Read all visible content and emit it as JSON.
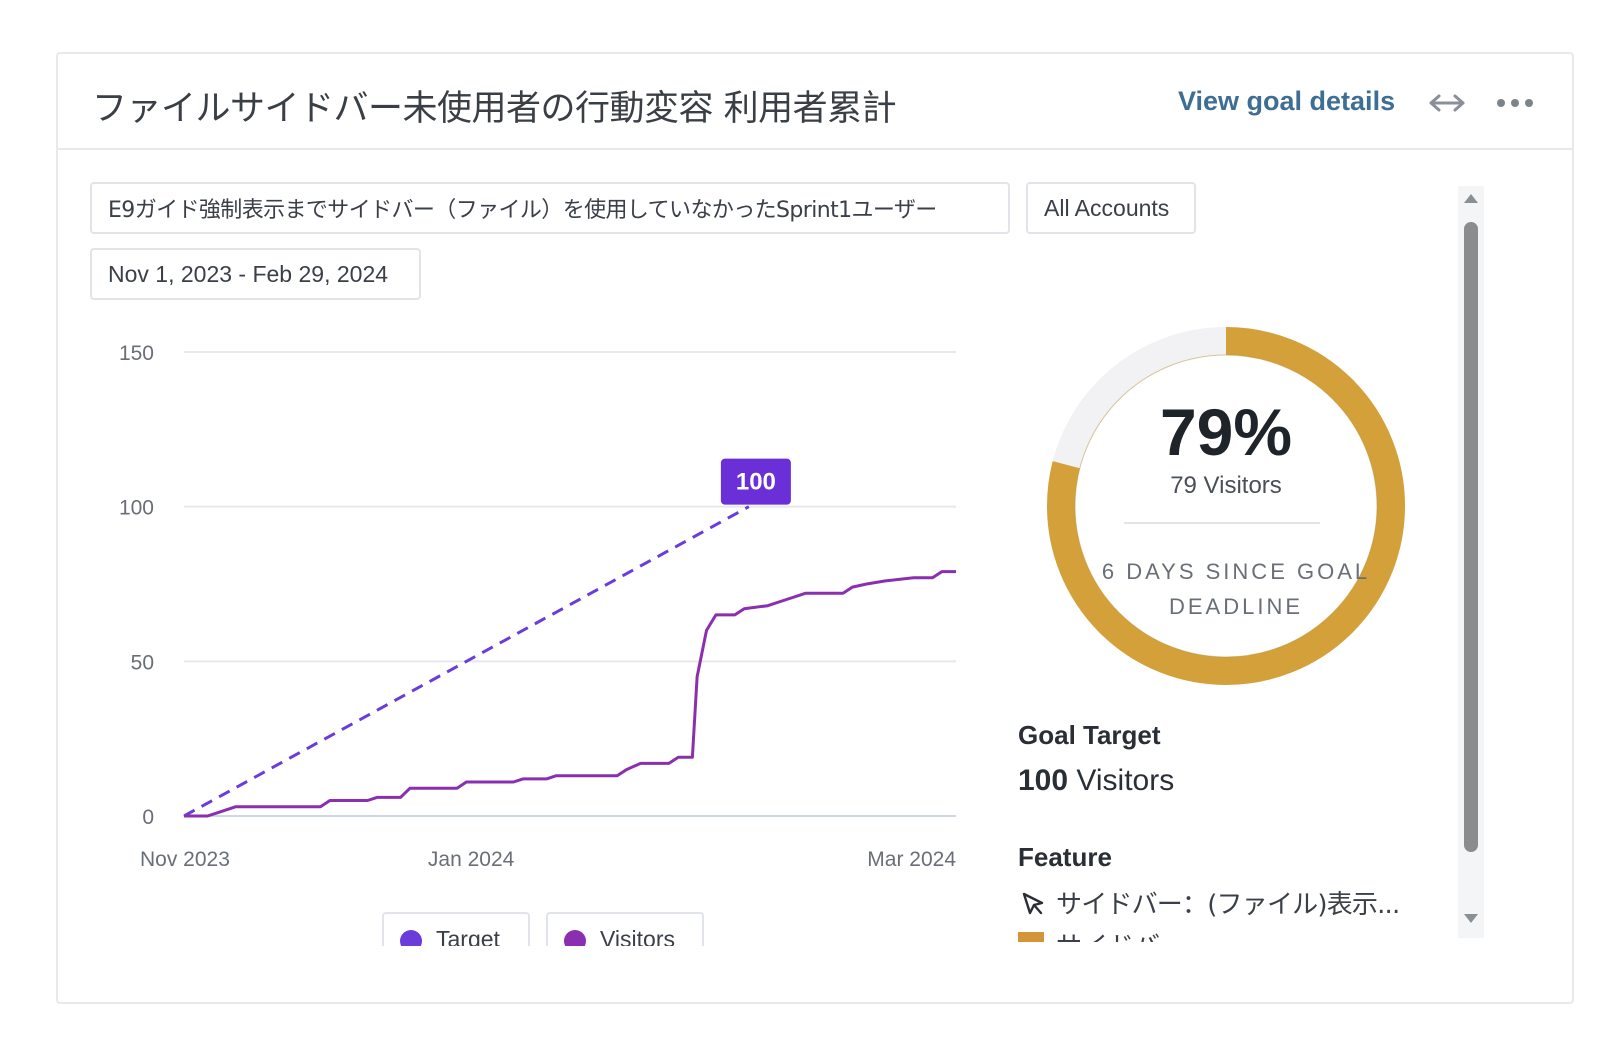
{
  "header": {
    "title": "ファイルサイドバー未使用者の行動変容 利用者累計",
    "view_goal_details": "View goal details",
    "expand_icon": "expand-horizontal-icon",
    "more_icon": "more-horizontal-icon"
  },
  "filters": {
    "segment": "E9ガイド強制表示までサイドバー（ファイル）を使用していなかったSprint1ユーザー",
    "accounts": "All Accounts",
    "date_range": "Nov 1, 2023 - Feb 29, 2024"
  },
  "chart_data": {
    "type": "line",
    "x_ticks": [
      "Nov 2023",
      "Jan 2024",
      "Mar 2024"
    ],
    "ylim": [
      0,
      150
    ],
    "y_ticks": [
      "0",
      "50",
      "100",
      "150"
    ],
    "grid": true,
    "series": [
      {
        "name": "Target",
        "style": "dashed",
        "color": "#6a3ddb",
        "points": [
          [
            "2023-11-01",
            0
          ],
          [
            "2024-02-29",
            100
          ]
        ],
        "end_label": "100"
      },
      {
        "name": "Visitors",
        "style": "solid",
        "color": "#8a2fb0",
        "points": [
          [
            "2023-11-01",
            0
          ],
          [
            "2023-11-06",
            0
          ],
          [
            "2023-11-08",
            1
          ],
          [
            "2023-11-12",
            3
          ],
          [
            "2023-11-30",
            3
          ],
          [
            "2023-12-02",
            5
          ],
          [
            "2023-12-10",
            5
          ],
          [
            "2023-12-12",
            6
          ],
          [
            "2023-12-17",
            6
          ],
          [
            "2023-12-19",
            9
          ],
          [
            "2023-12-29",
            9
          ],
          [
            "2023-12-31",
            11
          ],
          [
            "2024-01-10",
            11
          ],
          [
            "2024-01-12",
            12
          ],
          [
            "2024-01-17",
            12
          ],
          [
            "2024-01-19",
            13
          ],
          [
            "2024-02-01",
            13
          ],
          [
            "2024-02-03",
            15
          ],
          [
            "2024-02-06",
            17
          ],
          [
            "2024-02-12",
            17
          ],
          [
            "2024-02-14",
            19
          ],
          [
            "2024-02-17",
            19
          ],
          [
            "2024-02-18",
            45
          ],
          [
            "2024-02-20",
            60
          ],
          [
            "2024-02-22",
            65
          ],
          [
            "2024-02-26",
            65
          ],
          [
            "2024-02-28",
            67
          ],
          [
            "2024-03-04",
            68
          ],
          [
            "2024-03-08",
            70
          ],
          [
            "2024-03-12",
            72
          ],
          [
            "2024-03-20",
            72
          ],
          [
            "2024-03-22",
            74
          ],
          [
            "2024-03-25",
            75
          ],
          [
            "2024-03-29",
            76
          ],
          [
            "2024-04-04",
            77
          ],
          [
            "2024-04-08",
            77
          ],
          [
            "2024-04-10",
            79
          ],
          [
            "2024-04-13",
            79
          ]
        ]
      }
    ],
    "legend": [
      "Target",
      "Visitors"
    ]
  },
  "goal": {
    "percent_text": "79%",
    "percent_value": 0.79,
    "visitors_text": "79 Visitors",
    "deadline_text": "6 DAYS SINCE GOAL DEADLINE",
    "progress_color": "#d4a03a",
    "track_color": "#f2f2f4",
    "target_label": "Goal Target",
    "target_number": "100",
    "target_unit": "Visitors",
    "feature_label": "Feature",
    "feature_item": "サイドバー：(ファイル)表示...",
    "feature_icon": "cursor-click-icon",
    "feature_item_2": "サイドバー"
  }
}
